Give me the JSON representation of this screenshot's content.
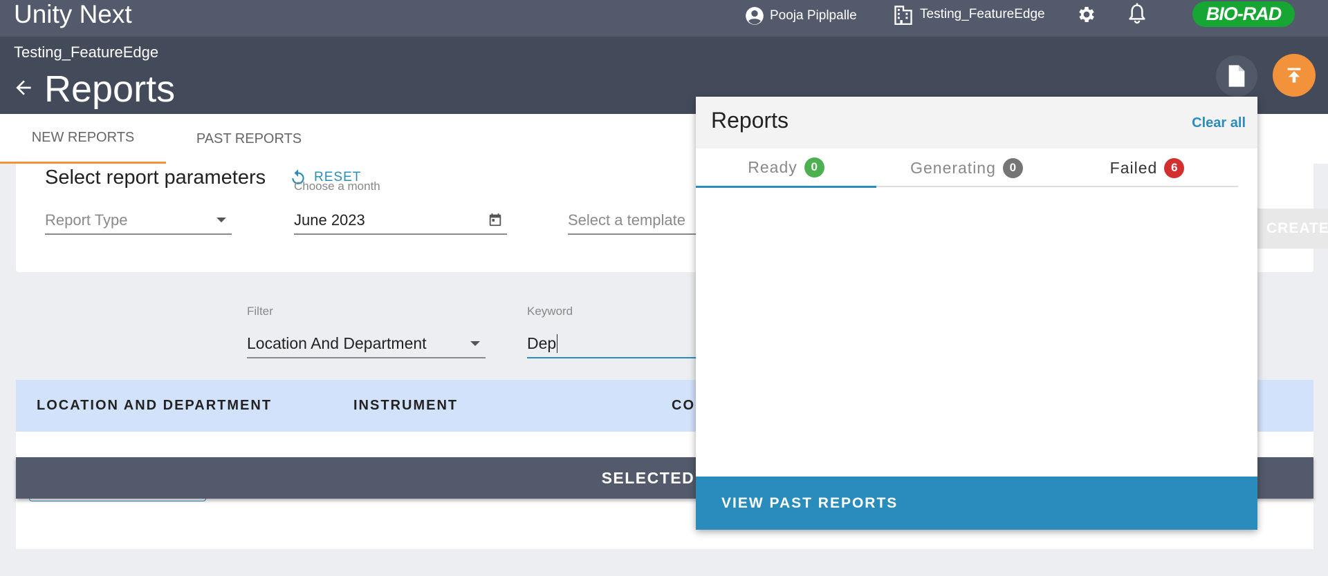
{
  "app": {
    "title": "Unity Next"
  },
  "topbar": {
    "user_name": "Pooja Piplpalle",
    "lab_name": "Testing_FeatureEdge",
    "icons": {
      "user": "account-circle-icon",
      "lab": "building-icon",
      "settings": "gear-icon",
      "notifications": "bell-icon"
    },
    "logo_text": "BIO-RAD",
    "logo_color": "#17a533"
  },
  "subheader": {
    "lab_name": "Testing_FeatureEdge",
    "page_title": "Reports"
  },
  "tabs": [
    {
      "label": "NEW REPORTS",
      "active": true
    },
    {
      "label": "PAST REPORTS",
      "active": false
    }
  ],
  "parameters": {
    "title": "Select report parameters",
    "reset_label": "RESET",
    "report_type_placeholder": "Report Type",
    "month_label": "Choose a month",
    "month_value": "June 2023",
    "template_placeholder": "Select a template",
    "create_label": "CREATE"
  },
  "filter": {
    "filter_label": "Filter",
    "filter_value": "Location And Department",
    "keyword_label": "Keyword",
    "keyword_value": "Dep"
  },
  "table": {
    "columns": [
      "LOCATION AND DEPARTMENT",
      "INSTRUMENT",
      "CO"
    ],
    "selected_bar_label": "SELECTED ITE"
  },
  "popup": {
    "title": "Reports",
    "clear_all": "Clear all",
    "tabs": [
      {
        "label": "Ready",
        "count": "0",
        "badge_color": "#4caf50"
      },
      {
        "label": "Generating",
        "count": "0",
        "badge_color": "#757575"
      },
      {
        "label": "Failed",
        "count": "6",
        "badge_color": "#d32f2f"
      }
    ],
    "view_past_label": "VIEW PAST REPORTS"
  },
  "colors": {
    "accent_blue": "#2a8cbd",
    "accent_orange": "#f2923a",
    "header_dark": "#434a5a",
    "topbar": "#525a6b"
  }
}
